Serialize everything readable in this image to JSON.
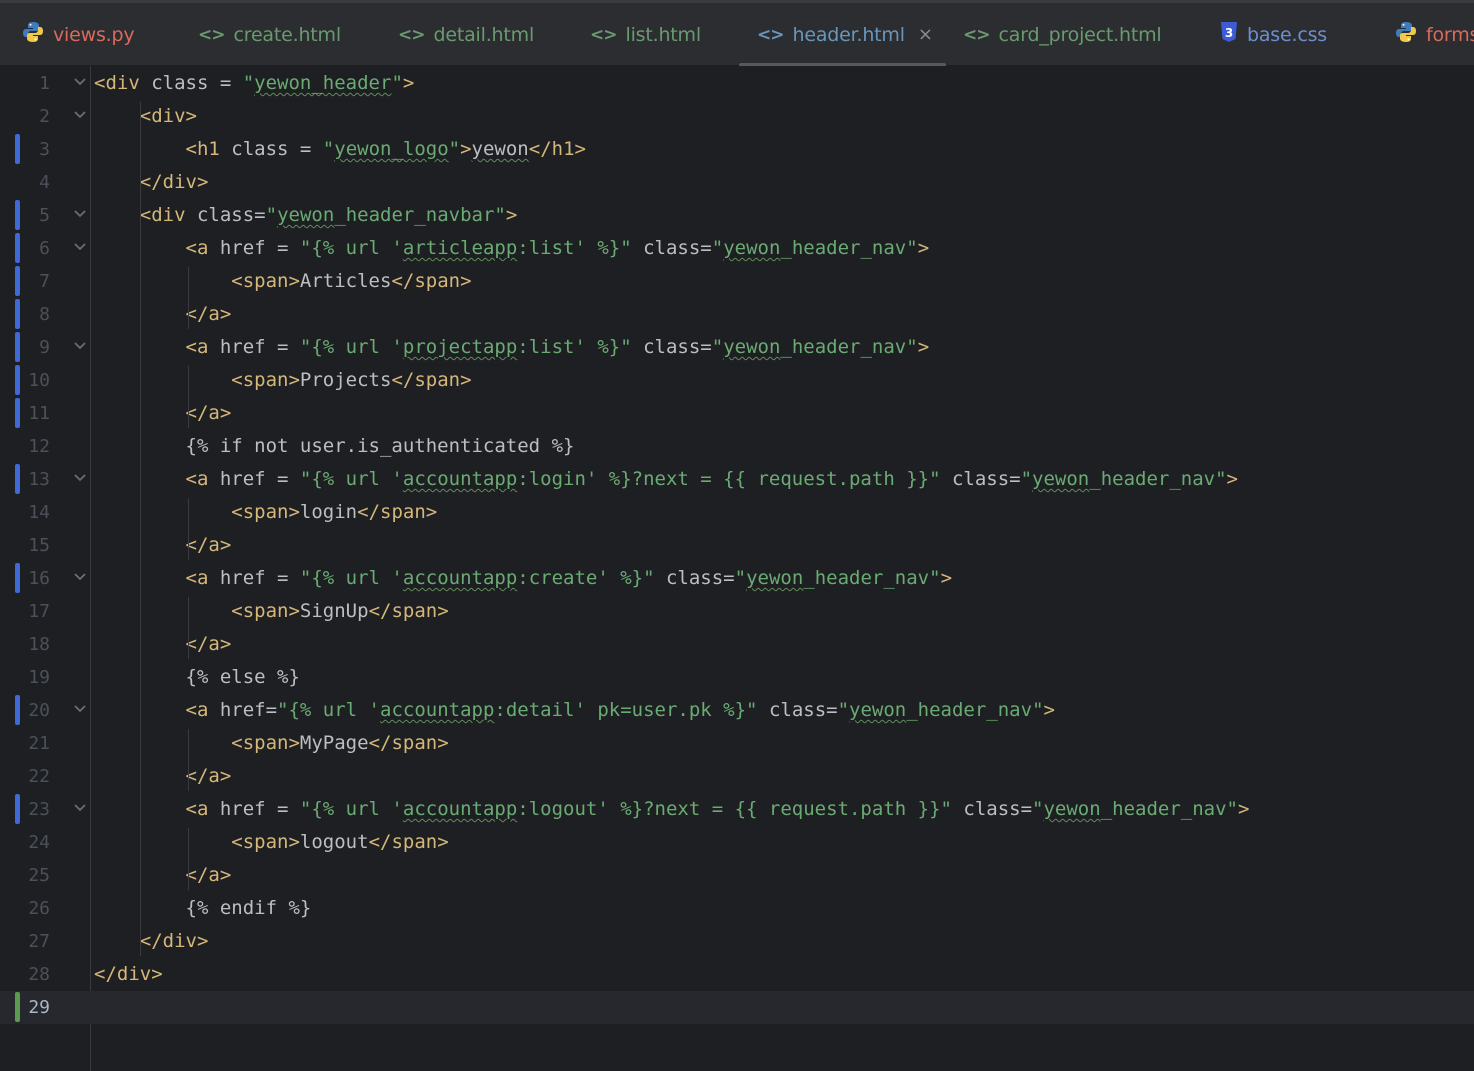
{
  "tabs": [
    {
      "label": "views.py",
      "type": "py",
      "active": false
    },
    {
      "label": "create.html",
      "type": "html",
      "active": false
    },
    {
      "label": "detail.html",
      "type": "html",
      "active": false
    },
    {
      "label": "list.html",
      "type": "html",
      "active": false
    },
    {
      "label": "header.html",
      "type": "html",
      "active": true
    },
    {
      "label": "card_project.html",
      "type": "html",
      "active": false
    },
    {
      "label": "base.css",
      "type": "css",
      "active": false
    },
    {
      "label": "forms",
      "type": "py",
      "active": false
    }
  ],
  "close_glyph": "×",
  "html_icon_glyph": "<>",
  "css_icon_glyph": "3",
  "fold_glyph": "⌄",
  "colors": {
    "tag": "#d5b779",
    "string": "#6aab73",
    "text": "#bcbec4",
    "change_marker": "#3d6ad6",
    "added_marker": "#5a9b4f"
  },
  "lines": [
    {
      "n": "1",
      "fold": true,
      "change": null,
      "t": [
        [
          "tag",
          "<div "
        ],
        [
          "attr",
          "class = "
        ],
        [
          "str",
          "\""
        ],
        [
          "strw",
          "yewon_header"
        ],
        [
          "str",
          "\""
        ],
        [
          "tag",
          ">"
        ]
      ]
    },
    {
      "n": "2",
      "fold": true,
      "change": null,
      "t": [
        [
          "txt",
          "    "
        ],
        [
          "tag",
          "<div>"
        ]
      ]
    },
    {
      "n": "3",
      "fold": false,
      "change": "mod",
      "t": [
        [
          "txt",
          "        "
        ],
        [
          "tag",
          "<h1 "
        ],
        [
          "attr",
          "class = "
        ],
        [
          "str",
          "\""
        ],
        [
          "strw",
          "yewon_logo"
        ],
        [
          "str",
          "\""
        ],
        [
          "tag",
          ">"
        ],
        [
          "txtw",
          "yewon"
        ],
        [
          "tag",
          "</h1>"
        ]
      ]
    },
    {
      "n": "4",
      "fold": false,
      "change": null,
      "t": [
        [
          "txt",
          "    "
        ],
        [
          "tag",
          "</div>"
        ]
      ]
    },
    {
      "n": "5",
      "fold": true,
      "change": "mod",
      "t": [
        [
          "txt",
          "    "
        ],
        [
          "tag",
          "<div "
        ],
        [
          "attr",
          "class="
        ],
        [
          "str",
          "\""
        ],
        [
          "strw",
          "yewon"
        ],
        [
          "str",
          "_header_navbar\""
        ],
        [
          "tag",
          ">"
        ]
      ]
    },
    {
      "n": "6",
      "fold": true,
      "change": "mod",
      "t": [
        [
          "txt",
          "        "
        ],
        [
          "tag",
          "<a "
        ],
        [
          "attr",
          "href = "
        ],
        [
          "str",
          "\"{% url '"
        ],
        [
          "strw",
          "articleapp"
        ],
        [
          "str",
          ":list' %}\" "
        ],
        [
          "attr",
          "class="
        ],
        [
          "str",
          "\""
        ],
        [
          "strw",
          "yewon"
        ],
        [
          "str",
          "_header_nav\""
        ],
        [
          "tag",
          ">"
        ]
      ]
    },
    {
      "n": "7",
      "fold": false,
      "change": "mod",
      "t": [
        [
          "txt",
          "            "
        ],
        [
          "tag",
          "<span>"
        ],
        [
          "txt",
          "Articles"
        ],
        [
          "tag",
          "</span>"
        ]
      ]
    },
    {
      "n": "8",
      "fold": false,
      "change": "mod",
      "t": [
        [
          "txt",
          "        "
        ],
        [
          "tag",
          "</a>"
        ]
      ]
    },
    {
      "n": "9",
      "fold": true,
      "change": "mod",
      "t": [
        [
          "txt",
          "        "
        ],
        [
          "tag",
          "<a "
        ],
        [
          "attr",
          "href = "
        ],
        [
          "str",
          "\"{% url '"
        ],
        [
          "strw",
          "projectapp"
        ],
        [
          "str",
          ":list' %}\" "
        ],
        [
          "attr",
          "class="
        ],
        [
          "str",
          "\""
        ],
        [
          "strw",
          "yewon"
        ],
        [
          "str",
          "_header_nav\""
        ],
        [
          "tag",
          ">"
        ]
      ]
    },
    {
      "n": "10",
      "fold": false,
      "change": "mod",
      "t": [
        [
          "txt",
          "            "
        ],
        [
          "tag",
          "<span>"
        ],
        [
          "txt",
          "Projects"
        ],
        [
          "tag",
          "</span>"
        ]
      ]
    },
    {
      "n": "11",
      "fold": false,
      "change": "mod",
      "t": [
        [
          "txt",
          "        "
        ],
        [
          "tag",
          "</a>"
        ]
      ]
    },
    {
      "n": "12",
      "fold": false,
      "change": null,
      "t": [
        [
          "txt",
          "        "
        ],
        [
          "tpl",
          "{% if not user.is_authenticated %}"
        ]
      ]
    },
    {
      "n": "13",
      "fold": true,
      "change": "mod",
      "t": [
        [
          "txt",
          "        "
        ],
        [
          "tag",
          "<a "
        ],
        [
          "attr",
          "href = "
        ],
        [
          "str",
          "\"{% url '"
        ],
        [
          "strw",
          "accountapp"
        ],
        [
          "str",
          ":login' %}?next = {{ request.path }}\" "
        ],
        [
          "attr",
          "class="
        ],
        [
          "str",
          "\""
        ],
        [
          "strw",
          "yewon"
        ],
        [
          "str",
          "_header_nav\""
        ],
        [
          "tag",
          ">"
        ]
      ]
    },
    {
      "n": "14",
      "fold": false,
      "change": null,
      "t": [
        [
          "txt",
          "            "
        ],
        [
          "tag",
          "<span>"
        ],
        [
          "txt",
          "login"
        ],
        [
          "tag",
          "</span>"
        ]
      ]
    },
    {
      "n": "15",
      "fold": false,
      "change": null,
      "t": [
        [
          "txt",
          "        "
        ],
        [
          "tag",
          "</a>"
        ]
      ]
    },
    {
      "n": "16",
      "fold": true,
      "change": "mod",
      "t": [
        [
          "txt",
          "        "
        ],
        [
          "tag",
          "<a "
        ],
        [
          "attr",
          "href = "
        ],
        [
          "str",
          "\"{% url '"
        ],
        [
          "strw",
          "accountapp"
        ],
        [
          "str",
          ":create' %}\" "
        ],
        [
          "attr",
          "class="
        ],
        [
          "str",
          "\""
        ],
        [
          "strw",
          "yewon"
        ],
        [
          "str",
          "_header_nav\""
        ],
        [
          "tag",
          ">"
        ]
      ]
    },
    {
      "n": "17",
      "fold": false,
      "change": null,
      "t": [
        [
          "txt",
          "            "
        ],
        [
          "tag",
          "<span>"
        ],
        [
          "txt",
          "SignUp"
        ],
        [
          "tag",
          "</span>"
        ]
      ]
    },
    {
      "n": "18",
      "fold": false,
      "change": null,
      "t": [
        [
          "txt",
          "        "
        ],
        [
          "tag",
          "</a>"
        ]
      ]
    },
    {
      "n": "19",
      "fold": false,
      "change": null,
      "t": [
        [
          "txt",
          "        "
        ],
        [
          "tpl",
          "{% else %}"
        ]
      ]
    },
    {
      "n": "20",
      "fold": true,
      "change": "mod",
      "t": [
        [
          "txt",
          "        "
        ],
        [
          "tag",
          "<a "
        ],
        [
          "attr",
          "href="
        ],
        [
          "str",
          "\"{% url '"
        ],
        [
          "strw",
          "accountapp"
        ],
        [
          "str",
          ":detail' pk=user.pk %}\" "
        ],
        [
          "attr",
          "class="
        ],
        [
          "str",
          "\""
        ],
        [
          "strw",
          "yewon"
        ],
        [
          "str",
          "_header_nav\""
        ],
        [
          "tag",
          ">"
        ]
      ]
    },
    {
      "n": "21",
      "fold": false,
      "change": null,
      "t": [
        [
          "txt",
          "            "
        ],
        [
          "tag",
          "<span>"
        ],
        [
          "txt",
          "MyPage"
        ],
        [
          "tag",
          "</span>"
        ]
      ]
    },
    {
      "n": "22",
      "fold": false,
      "change": null,
      "t": [
        [
          "txt",
          "        "
        ],
        [
          "tag",
          "</a>"
        ]
      ]
    },
    {
      "n": "23",
      "fold": true,
      "change": "mod",
      "t": [
        [
          "txt",
          "        "
        ],
        [
          "tag",
          "<a "
        ],
        [
          "attr",
          "href = "
        ],
        [
          "str",
          "\"{% url '"
        ],
        [
          "strw",
          "accountapp"
        ],
        [
          "str",
          ":logout' %}?next = {{ request.path }}\" "
        ],
        [
          "attr",
          "class="
        ],
        [
          "str",
          "\""
        ],
        [
          "strw",
          "yewon"
        ],
        [
          "str",
          "_header_nav\""
        ],
        [
          "tag",
          ">"
        ]
      ]
    },
    {
      "n": "24",
      "fold": false,
      "change": null,
      "t": [
        [
          "txt",
          "            "
        ],
        [
          "tag",
          "<span>"
        ],
        [
          "txt",
          "logout"
        ],
        [
          "tag",
          "</span>"
        ]
      ]
    },
    {
      "n": "25",
      "fold": false,
      "change": null,
      "t": [
        [
          "txt",
          "        "
        ],
        [
          "tag",
          "</a>"
        ]
      ]
    },
    {
      "n": "26",
      "fold": false,
      "change": null,
      "t": [
        [
          "txt",
          "        "
        ],
        [
          "tpl",
          "{% endif %}"
        ]
      ]
    },
    {
      "n": "27",
      "fold": false,
      "change": null,
      "t": [
        [
          "txt",
          "    "
        ],
        [
          "tag",
          "</div>"
        ]
      ]
    },
    {
      "n": "28",
      "fold": false,
      "change": null,
      "t": [
        [
          "tag",
          "</div>"
        ]
      ]
    },
    {
      "n": "29",
      "fold": false,
      "change": "add",
      "current": true,
      "t": []
    }
  ]
}
